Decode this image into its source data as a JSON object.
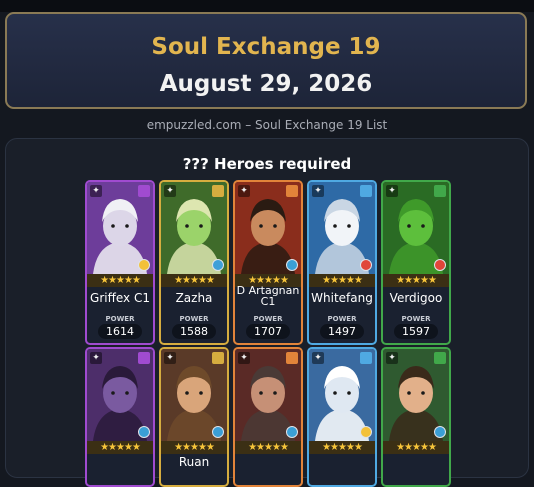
{
  "banner": {
    "title": "Soul Exchange 19",
    "date": "August 29, 2026"
  },
  "source_line": "empuzzled.com – Soul Exchange 19 List",
  "panel": {
    "title": "??? Heroes required",
    "power_label": "POWER"
  },
  "heroes_row1": [
    {
      "name": "Griffex C1",
      "power": "1614",
      "stars": "★★★★★",
      "element": "holy",
      "border": "#a04bd0",
      "bg": "#6d3d9a",
      "skin": "#dcd6e8",
      "hair": "#f0f0f5",
      "emblem": "#f3c13a"
    },
    {
      "name": "Zazha",
      "power": "1588",
      "stars": "★★★★★",
      "element": "nature",
      "border": "#d6ad3f",
      "bg": "#3f6b2a",
      "skin": "#9bd36a",
      "hair": "#dde6b0",
      "emblem": "#3fa0d8"
    },
    {
      "name": "D Artagnan C1",
      "power": "1707",
      "stars": "★★★★★",
      "element": "fire",
      "border": "#e2843a",
      "bg": "#8a2d1c",
      "skin": "#c98a5e",
      "hair": "#2a1b12",
      "emblem": "#3b9fd6"
    },
    {
      "name": "Whitefang",
      "power": "1497",
      "stars": "★★★★★",
      "element": "ice",
      "border": "#4fa9e2",
      "bg": "#2e6aa6",
      "skin": "#f1f4f8",
      "hair": "#c9d6e4",
      "emblem": "#e0463a"
    },
    {
      "name": "Verdigoo",
      "power": "1597",
      "stars": "★★★★★",
      "element": "nature",
      "border": "#41a84a",
      "bg": "#2a6b24",
      "skin": "#5dbf3c",
      "hair": "#3f9a2a",
      "emblem": "#e0463a"
    }
  ],
  "heroes_row2": [
    {
      "name": "",
      "stars": "★★★★★",
      "element": "dark",
      "border": "#a04bd0",
      "bg": "#4d2e6a",
      "skin": "#7a5aa0",
      "hair": "#2a1a3a",
      "emblem": "#3b9fd6"
    },
    {
      "name": "Ruan",
      "stars": "★★★★★",
      "element": "holy",
      "border": "#d6ad3f",
      "bg": "#5a3a28",
      "skin": "#d9a57a",
      "hair": "#6e4a2a",
      "emblem": "#3b9fd6"
    },
    {
      "name": "",
      "stars": "★★★★★",
      "element": "fire",
      "border": "#e2843a",
      "bg": "#5a2a26",
      "skin": "#c69076",
      "hair": "#4a3a36",
      "emblem": "#3b9fd6"
    },
    {
      "name": "",
      "stars": "★★★★★",
      "element": "ice",
      "border": "#4fa9e2",
      "bg": "#3a6aa0",
      "skin": "#dfe8f2",
      "hair": "#ffffff",
      "emblem": "#f3c13a"
    },
    {
      "name": "",
      "stars": "★★★★★",
      "element": "nature",
      "border": "#41a84a",
      "bg": "#2f5a30",
      "skin": "#e2b08a",
      "hair": "#3a2a1a",
      "emblem": "#3b9fd6"
    }
  ]
}
